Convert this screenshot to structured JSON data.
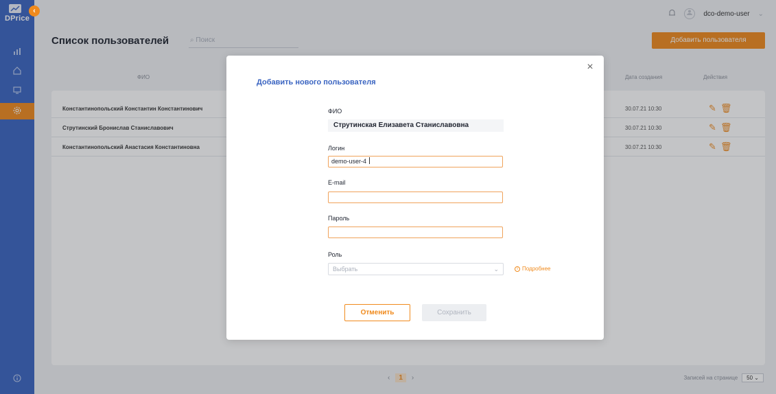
{
  "app": {
    "logo_text": "DPrice",
    "collapse_icon": "‹"
  },
  "header": {
    "user_name": "dco-demo-user",
    "user_chevron": "⌄"
  },
  "page": {
    "title": "Список пользователей",
    "search_placeholder": "Поиск",
    "add_button": "Добавить пользователя"
  },
  "table": {
    "columns": {
      "name": "ФИО",
      "created": "Дата создания",
      "actions": "Действия"
    },
    "rows": [
      {
        "name": "Константинопольский Константин Константинович",
        "created": "30.07.21 10:30"
      },
      {
        "name": "Струтинский Бронислав Станиславович",
        "created": "30.07.21 10:30"
      },
      {
        "name": "Константинопольский Анастасия Константиновна",
        "created": "30.07.21 10:30"
      }
    ]
  },
  "pagination": {
    "prev": "‹",
    "current": "1",
    "next": "›",
    "per_page_label": "Записей на странице",
    "per_page_value": "50"
  },
  "modal": {
    "title": "Добавить нового пользователя",
    "close": "×",
    "fio_label": "ФИО",
    "fio_value": "Струтинская Елизавета Станиславовна",
    "login_label": "Логин",
    "login_value": "demo-user-4",
    "email_label": "E-mail",
    "email_value": "",
    "password_label": "Пароль",
    "password_value": "",
    "role_label": "Роль",
    "role_placeholder": "Выбрать",
    "more_link": "Подробнее",
    "cancel_button": "Отменить",
    "save_button": "Сохранить"
  },
  "colors": {
    "sidebar": "#3a64c1",
    "accent": "#f08a1c",
    "title_blue": "#3a64c1"
  }
}
